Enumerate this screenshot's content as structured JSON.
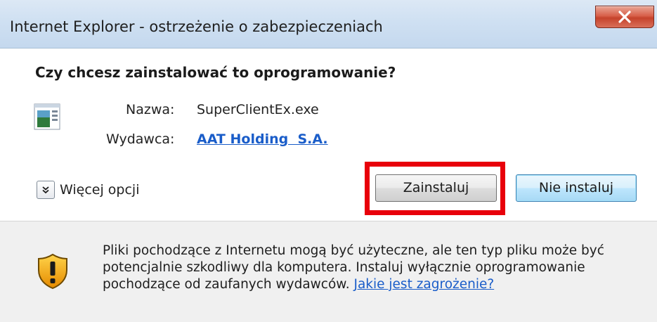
{
  "window": {
    "title": "Internet Explorer - ostrzeżenie o zabezpieczeniach",
    "close_icon": "close-icon"
  },
  "dialog": {
    "question": "Czy chcesz zainstalować to oprogramowanie?",
    "name_label": "Nazwa:",
    "name_value": "SuperClientEx.exe",
    "publisher_label": "Wydawca:",
    "publisher_value": "AAT Holding  S.A.",
    "more_options_label": "Więcej opcji",
    "install_button": "Zainstaluj",
    "dont_install_button": "Nie instaluj"
  },
  "footer": {
    "warning_text": "Pliki pochodzące z Internetu mogą być użyteczne, ale ten typ pliku może być potencjalnie szkodliwy dla komputera. Instaluj wyłącznie oprogramowanie pochodzące od zaufanych wydawców.",
    "risk_link": "Jakie jest zagrożenie?"
  },
  "colors": {
    "highlight": "#e8000b",
    "link": "#1a5dc9"
  }
}
